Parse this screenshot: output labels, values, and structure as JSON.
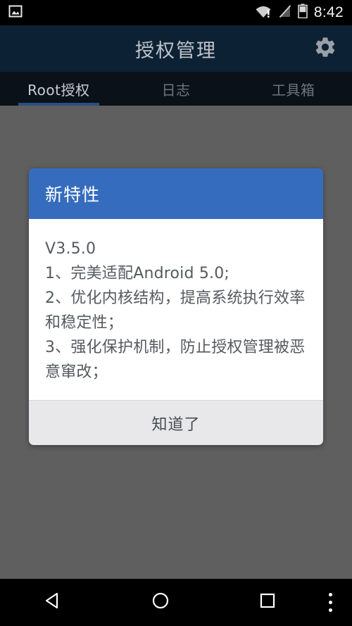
{
  "statusbar": {
    "icons": [
      "screenshot-image-icon",
      "wifi-warning-icon",
      "no-sim-signal-icon",
      "battery-icon"
    ],
    "time": "8:42"
  },
  "appbar": {
    "title": "授权管理",
    "settings_icon": "gear-icon"
  },
  "tabs": [
    {
      "label": "Root授权",
      "active": true
    },
    {
      "label": "日志",
      "active": false
    },
    {
      "label": "工具箱",
      "active": false
    }
  ],
  "dialog": {
    "title": "新特性",
    "lines": [
      "V3.5.0",
      "1、完美适配Android 5.0;",
      "2、优化内核结构，提高系统执行效率和稳定性；",
      "3、强化保护机制，防止授权管理被恶意窜改；"
    ],
    "confirm_label": "知道了"
  },
  "navbar": {
    "back": "back-triangle-icon",
    "home": "home-circle-icon",
    "recents": "recents-square-icon",
    "menu": "overflow-menu-icon"
  },
  "colors": {
    "accent_blue": "#356cbe",
    "appbar_bg": "#0c2134",
    "tabbar_bg": "#0a1119",
    "scrim": "#5f5f5f",
    "tab_indicator": "#2c507f"
  }
}
